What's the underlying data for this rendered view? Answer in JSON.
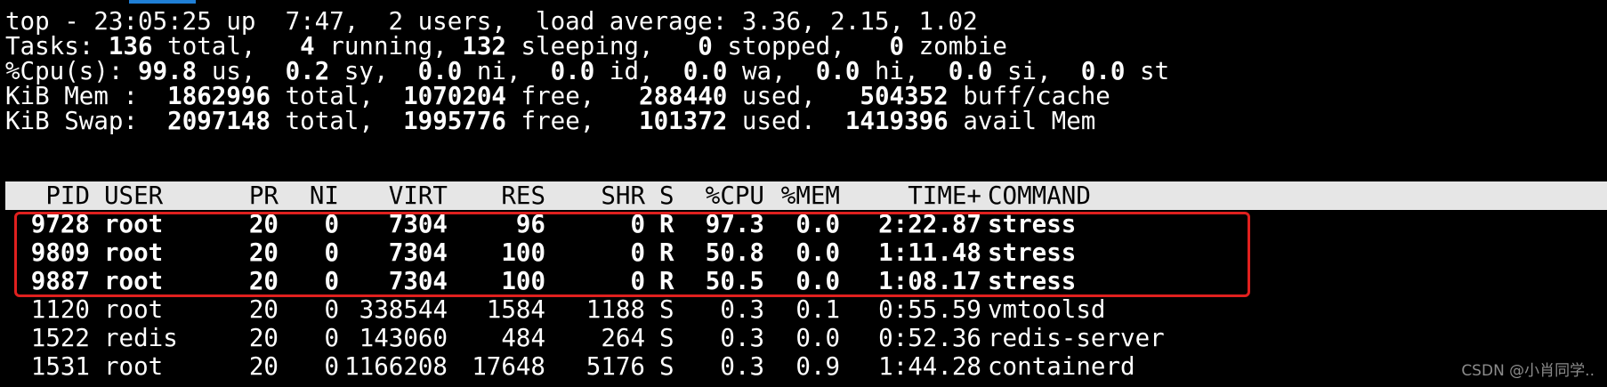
{
  "summary": {
    "line1": "top - 23:05:25 up  7:47,  2 users,  load average: 3.36, 2.15, 1.02",
    "tasks": {
      "label": "Tasks:",
      "total": "136",
      "total_label": "total,",
      "running": "4",
      "running_label": "running,",
      "sleeping": "132",
      "sleeping_label": "sleeping,",
      "stopped": "0",
      "stopped_label": "stopped,",
      "zombie": "0",
      "zombie_label": "zombie"
    },
    "cpu": {
      "label": "%Cpu(s):",
      "us": "99.8",
      "us_label": "us,",
      "sy": "0.2",
      "sy_label": "sy,",
      "ni": "0.0",
      "ni_label": "ni,",
      "id": "0.0",
      "id_label": "id,",
      "wa": "0.0",
      "wa_label": "wa,",
      "hi": "0.0",
      "hi_label": "hi,",
      "si": "0.0",
      "si_label": "si,",
      "st": "0.0",
      "st_label": "st"
    },
    "mem": {
      "label": "KiB Mem :",
      "total": "1862996",
      "total_label": "total,",
      "free": "1070204",
      "free_label": "free,",
      "used": "288440",
      "used_label": "used,",
      "buff": "504352",
      "buff_label": "buff/cache"
    },
    "swap": {
      "label": "KiB Swap:",
      "total": "2097148",
      "total_label": "total,",
      "free": "1995776",
      "free_label": "free,",
      "used": "101372",
      "used_label": "used.",
      "avail": "1419396",
      "avail_label": "avail Mem"
    }
  },
  "table": {
    "headers": {
      "pid": "PID",
      "user": "USER",
      "pr": "PR",
      "ni": "NI",
      "virt": "VIRT",
      "res": "RES",
      "shr": "SHR",
      "s": "S",
      "cpu": "%CPU",
      "mem": "%MEM",
      "time": "TIME+",
      "command": "COMMAND"
    },
    "rows": [
      {
        "pid": "9728",
        "user": "root",
        "pr": "20",
        "ni": "0",
        "virt": "7304",
        "res": "96",
        "shr": "0",
        "s": "R",
        "cpu": "97.3",
        "mem": "0.0",
        "time": "2:22.87",
        "command": "stress"
      },
      {
        "pid": "9809",
        "user": "root",
        "pr": "20",
        "ni": "0",
        "virt": "7304",
        "res": "100",
        "shr": "0",
        "s": "R",
        "cpu": "50.8",
        "mem": "0.0",
        "time": "1:11.48",
        "command": "stress"
      },
      {
        "pid": "9887",
        "user": "root",
        "pr": "20",
        "ni": "0",
        "virt": "7304",
        "res": "100",
        "shr": "0",
        "s": "R",
        "cpu": "50.5",
        "mem": "0.0",
        "time": "1:08.17",
        "command": "stress"
      },
      {
        "pid": "1120",
        "user": "root",
        "pr": "20",
        "ni": "0",
        "virt": "338544",
        "res": "1584",
        "shr": "1188",
        "s": "S",
        "cpu": "0.3",
        "mem": "0.1",
        "time": "0:55.59",
        "command": "vmtoolsd"
      },
      {
        "pid": "1522",
        "user": "redis",
        "pr": "20",
        "ni": "0",
        "virt": "143060",
        "res": "484",
        "shr": "264",
        "s": "S",
        "cpu": "0.3",
        "mem": "0.0",
        "time": "0:52.36",
        "command": "redis-server"
      },
      {
        "pid": "1531",
        "user": "root",
        "pr": "20",
        "ni": "0",
        "virt": "1166208",
        "res": "17648",
        "shr": "5176",
        "s": "S",
        "cpu": "0.3",
        "mem": "0.9",
        "time": "1:44.28",
        "command": "containerd"
      }
    ]
  },
  "watermark": "CSDN @小肖同学..",
  "colors": {
    "background": "#000000",
    "text": "#ffffff",
    "header_bar": "#e6e6e6",
    "highlight_border": "#e0201e",
    "tab_accent": "#1f7fd6"
  }
}
